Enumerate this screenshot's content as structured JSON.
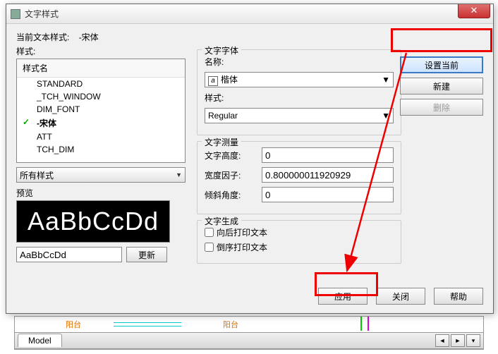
{
  "window": {
    "title": "文字样式"
  },
  "current_style_label": "当前文本样式:",
  "current_style_value": "-宋体",
  "styles_label": "样式:",
  "list_header": "样式名",
  "styles": [
    "STANDARD",
    "_TCH_WINDOW",
    "DIM_FONT",
    "-宋体",
    "ATT",
    "TCH_DIM"
  ],
  "current_index": 3,
  "filter_combo": "所有样式",
  "preview_label": "预览",
  "preview_text": "AaBbCcDd",
  "preview_input": "AaBbCcDd",
  "update_btn": "更新",
  "font_group": {
    "title": "文字字体",
    "name_label": "名称:",
    "name_value": "楷体",
    "style_label": "样式:",
    "style_value": "Regular"
  },
  "measure_group": {
    "title": "文字测量",
    "height_label": "文字高度:",
    "height_value": "0",
    "width_label": "宽度因子:",
    "width_value": "0.800000011920929",
    "oblique_label": "倾斜角度:",
    "oblique_value": "0"
  },
  "gen_group": {
    "title": "文字生成",
    "backwards": "向后打印文本",
    "upsidedown": "倒序打印文本"
  },
  "right_buttons": {
    "set_current": "设置当前",
    "new": "新建",
    "delete": "删除"
  },
  "bottom_buttons": {
    "apply": "应用",
    "close": "关闭",
    "help": "帮助"
  },
  "bg": {
    "label1": "阳台",
    "label2": "阳台",
    "tab": "Model"
  }
}
